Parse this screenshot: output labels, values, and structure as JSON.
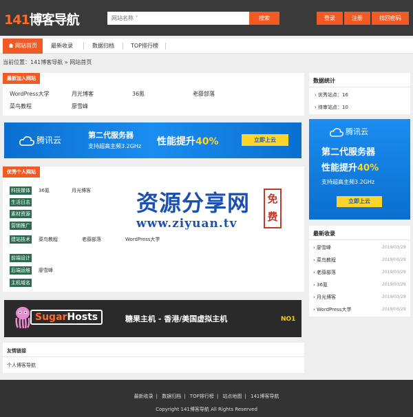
{
  "header": {
    "logo_num": "141",
    "logo_text": "博客导航",
    "search_placeholder": "网站名称 ˅",
    "search_button": "搜索",
    "buttons": [
      "登录",
      "注册",
      "找回密码"
    ]
  },
  "nav": {
    "items": [
      "网站首页",
      "最新收录",
      "数据归档",
      "TOP排行榜"
    ]
  },
  "breadcrumb": "当前位置：141博客导航 » 网站首页",
  "latest_sites": {
    "title": "最新加入网站",
    "row1": [
      "WordPress大学",
      "月光博客",
      "36氪",
      "老薛部落"
    ],
    "row2": [
      "菜鸟教程",
      "廖雪峰"
    ]
  },
  "banner_wide": {
    "brand": "腾讯云",
    "headline": "第二代服务器",
    "subline": "支持超高主频3.2GHz",
    "perf": "性能提升",
    "pct": "40%",
    "cta": "立即上云"
  },
  "banner_side": {
    "brand": "腾讯云",
    "line1": "第二代服务器",
    "line2": "性能提升",
    "pct": "40%",
    "line3": "支持超高主频3.2GHz",
    "cta": "立即上云"
  },
  "personal_sites": {
    "title": "优秀个人网站",
    "categories": [
      "科技媒体",
      "生活日志",
      "素材资源",
      "营销推广",
      "建站技术",
      "前端设计",
      "后端运维",
      "主机域名"
    ],
    "tech_media_sites": [
      "36氪",
      "月光博客"
    ],
    "build_sites": [
      "菜鸟教程",
      "老薛部落",
      "WordPress大学"
    ],
    "backend_sites": [
      "廖雪峰"
    ]
  },
  "watermark": {
    "title": "资源分享网",
    "url": "www.ziyuan.tv",
    "seal": "免费"
  },
  "sugar_banner": {
    "logo_a": "Sugar",
    "logo_b": "Hosts",
    "slogan": "糖果主机 - 香港/美国虚拟主机",
    "badge": "NO1"
  },
  "friend_links": {
    "title": "友情链接",
    "item": "个人博客导航"
  },
  "stats": {
    "title": "数据统计",
    "items": [
      "优秀站点：16",
      "待审站点：10"
    ]
  },
  "recent": {
    "title": "最新收录",
    "items": [
      "廖雪峰",
      "菜鸟教程",
      "老薛部落",
      "36氪",
      "月光博客",
      "WordPress大学"
    ],
    "dates": [
      "2019/03/29",
      "2019/03/29",
      "2019/03/29",
      "2019/03/29",
      "2019/03/29",
      "2019/03/29"
    ]
  },
  "footer": {
    "links": [
      "最新收录",
      "数据归档",
      "TOP排行榜",
      "站点地图",
      "141博客导航"
    ],
    "copyright": "Copyright 141博客导航 All Rights Reserved"
  }
}
